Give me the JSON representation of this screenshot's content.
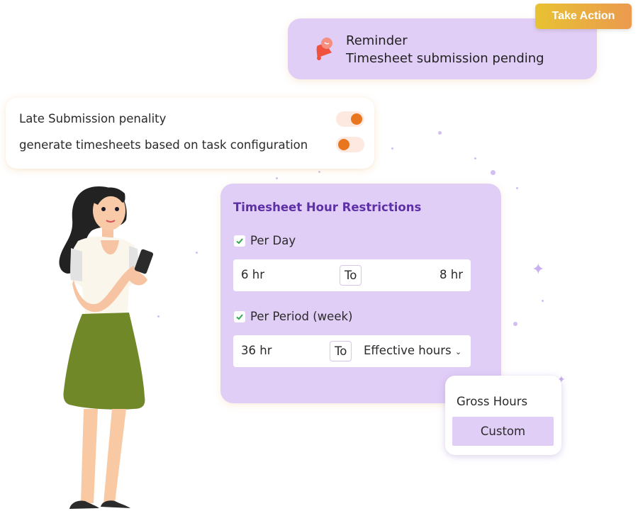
{
  "reminder": {
    "title": "Reminder",
    "message": "Timesheet submission pending",
    "action_label": "Take Action",
    "icon": "bell-icon"
  },
  "settings": {
    "items": [
      {
        "label": "Late Submission penality",
        "enabled": true
      },
      {
        "label": "generate timesheets based on task configuration",
        "enabled": false
      }
    ]
  },
  "restrictions": {
    "title": "Timesheet Hour Restrictions",
    "per_day": {
      "label": "Per Day",
      "checked": true,
      "from": "6 hr",
      "separator": "To",
      "to": "8 hr"
    },
    "per_period": {
      "label": "Per Period (week)",
      "checked": true,
      "from": "36 hr",
      "separator": "To",
      "type_selected": "Effective hours"
    }
  },
  "dropdown": {
    "options": [
      "Gross Hours",
      "Custom"
    ],
    "highlighted": "Custom"
  },
  "colors": {
    "card_purple": "#e1cef6",
    "title_purple": "#5d31a5",
    "toggle_orange": "#e8761f",
    "action_gradient_start": "#e8c233",
    "action_gradient_end": "#eb9a4e",
    "check_green": "#2fa84f"
  }
}
